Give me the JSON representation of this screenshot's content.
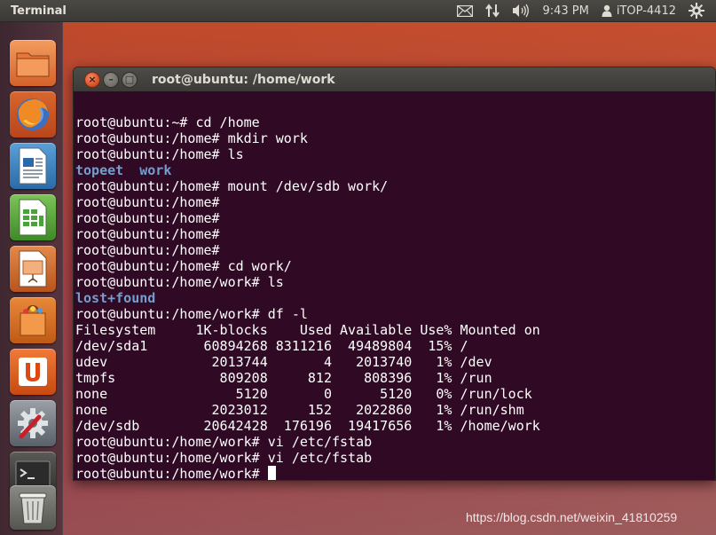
{
  "top_panel": {
    "app_title": "Terminal",
    "clock": "9:43 PM",
    "user": "iTOP-4412",
    "icons": [
      "mail-icon",
      "network-icon",
      "volume-icon",
      "user-icon",
      "gear-icon"
    ]
  },
  "launcher": {
    "items": [
      {
        "name": "home-folder",
        "icon": "folder-icon"
      },
      {
        "name": "firefox",
        "icon": "firefox-icon"
      },
      {
        "name": "libreoffice-writer",
        "icon": "writer-icon"
      },
      {
        "name": "libreoffice-calc",
        "icon": "calc-icon"
      },
      {
        "name": "libreoffice-impress",
        "icon": "impress-icon"
      },
      {
        "name": "software-center",
        "icon": "shopping-bag-icon"
      },
      {
        "name": "ubuntu-one",
        "icon": "ubuntu-one-icon"
      },
      {
        "name": "system-settings",
        "icon": "settings-icon"
      },
      {
        "name": "terminal",
        "icon": "terminal-icon"
      },
      {
        "name": "trash",
        "icon": "trash-icon"
      }
    ]
  },
  "window": {
    "title": "root@ubuntu: /home/work",
    "buttons": {
      "close": "×",
      "minimize": "–",
      "maximize": "□"
    }
  },
  "terminal": {
    "lines": [
      {
        "text": "",
        "type": "normal"
      },
      {
        "text": "root@ubuntu:~# cd /home",
        "type": "normal"
      },
      {
        "text": "root@ubuntu:/home# mkdir work",
        "type": "normal"
      },
      {
        "text": "root@ubuntu:/home# ls",
        "type": "normal"
      },
      {
        "text": "topeet  work",
        "type": "dir"
      },
      {
        "text": "root@ubuntu:/home# mount /dev/sdb work/",
        "type": "normal"
      },
      {
        "text": "root@ubuntu:/home#",
        "type": "normal"
      },
      {
        "text": "root@ubuntu:/home#",
        "type": "normal"
      },
      {
        "text": "root@ubuntu:/home#",
        "type": "normal"
      },
      {
        "text": "root@ubuntu:/home#",
        "type": "normal"
      },
      {
        "text": "root@ubuntu:/home# cd work/",
        "type": "normal"
      },
      {
        "text": "root@ubuntu:/home/work# ls",
        "type": "normal"
      },
      {
        "text": "lost+found",
        "type": "dir"
      },
      {
        "text": "root@ubuntu:/home/work# df -l",
        "type": "normal"
      },
      {
        "text": "Filesystem     1K-blocks    Used Available Use% Mounted on",
        "type": "normal"
      },
      {
        "text": "/dev/sda1       60894268 8311216  49489804  15% /",
        "type": "normal"
      },
      {
        "text": "udev             2013744       4   2013740   1% /dev",
        "type": "normal"
      },
      {
        "text": "tmpfs             809208     812    808396   1% /run",
        "type": "normal"
      },
      {
        "text": "none                5120       0      5120   0% /run/lock",
        "type": "normal"
      },
      {
        "text": "none             2023012     152   2022860   1% /run/shm",
        "type": "normal"
      },
      {
        "text": "/dev/sdb        20642428  176196  19417656   1% /home/work",
        "type": "normal"
      },
      {
        "text": "root@ubuntu:/home/work# vi /etc/fstab",
        "type": "normal"
      },
      {
        "text": "root@ubuntu:/home/work# vi /etc/fstab",
        "type": "normal"
      }
    ],
    "prompt": "root@ubuntu:/home/work# "
  },
  "watermark": "https://blog.csdn.net/weixin_41810259",
  "colors": {
    "terminal_bg": "#300a24",
    "terminal_fg": "#ffffff",
    "dir_color": "#729fcf",
    "panel_bg": "#3c3b37"
  }
}
